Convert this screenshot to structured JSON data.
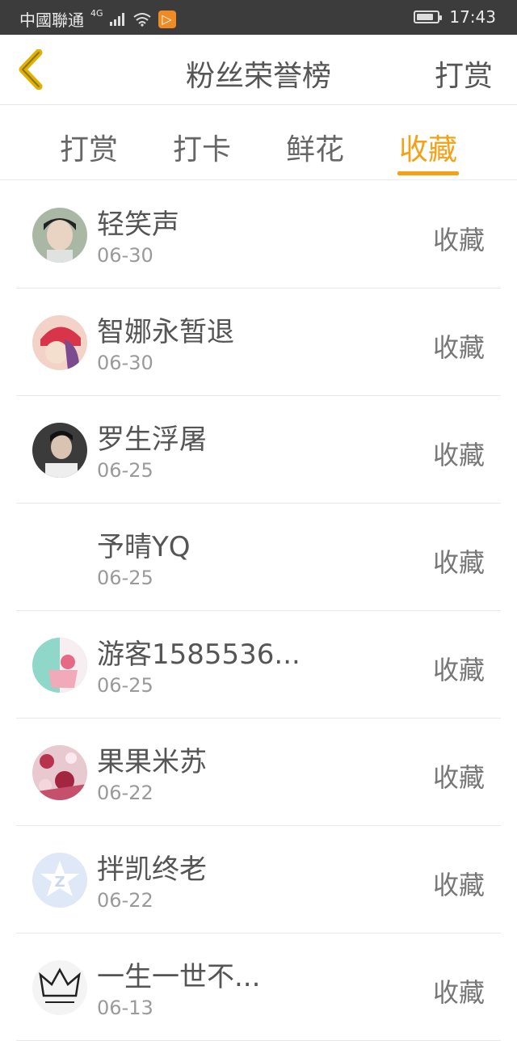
{
  "status_bar": {
    "carrier": "中國聯通",
    "network": "4G",
    "time": "17:43",
    "icons": [
      "signal-icon",
      "wifi-icon",
      "app-notification-icon",
      "battery-charging-icon"
    ]
  },
  "header": {
    "title": "粉丝荣誉榜",
    "action_label": "打赏",
    "back_icon": "chevron-left-icon"
  },
  "colors": {
    "accent": "#f5a115",
    "status_bar": "#3c3c3c",
    "text": "#555555",
    "subtext": "#9a9a9a"
  },
  "tabs": [
    {
      "label": "打赏",
      "active": false
    },
    {
      "label": "打卡",
      "active": false
    },
    {
      "label": "鲜花",
      "active": false
    },
    {
      "label": "收藏",
      "active": true
    }
  ],
  "fans": [
    {
      "name": "轻笑声",
      "date": "06-30",
      "action": "收藏",
      "avatar": "photo"
    },
    {
      "name": "智娜永暂退",
      "date": "06-30",
      "action": "收藏",
      "avatar": "anime"
    },
    {
      "name": "罗生浮屠",
      "date": "06-25",
      "action": "收藏",
      "avatar": "photo"
    },
    {
      "name": "予晴YQ",
      "date": "06-25",
      "action": "收藏",
      "avatar": "none"
    },
    {
      "name": "游客1585536...",
      "date": "06-25",
      "action": "收藏",
      "avatar": "cake"
    },
    {
      "name": "果果米苏",
      "date": "06-22",
      "action": "收藏",
      "avatar": "floral"
    },
    {
      "name": "拌凯终老",
      "date": "06-22",
      "action": "收藏",
      "avatar": "default-star"
    },
    {
      "name": "一生一世不...",
      "date": "06-13",
      "action": "收藏",
      "avatar": "crown"
    }
  ]
}
